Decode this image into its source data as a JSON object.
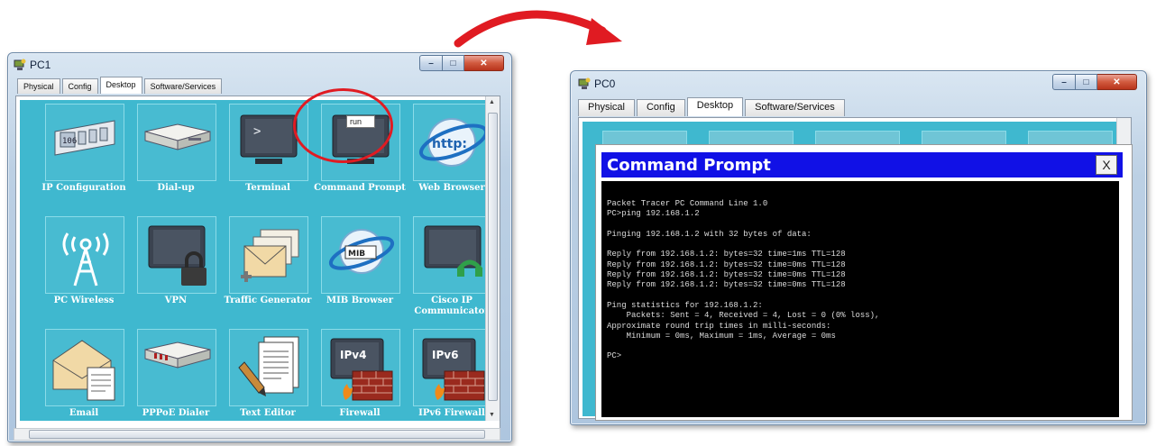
{
  "pc1": {
    "title": "PC1",
    "tabs": [
      "Physical",
      "Config",
      "Desktop",
      "Software/Services"
    ],
    "active_tab": "Desktop",
    "apps": [
      {
        "label": "IP Configuration",
        "icon": "ip-config-icon"
      },
      {
        "label": "Dial-up",
        "icon": "modem-icon"
      },
      {
        "label": "Terminal",
        "icon": "terminal-icon"
      },
      {
        "label": "Command Prompt",
        "icon": "command-prompt-icon"
      },
      {
        "label": "Web Browser",
        "icon": "web-browser-icon"
      },
      {
        "label": "PC Wireless",
        "icon": "wireless-antenna-icon"
      },
      {
        "label": "VPN",
        "icon": "vpn-lock-icon"
      },
      {
        "label": "Traffic Generator",
        "icon": "envelopes-icon"
      },
      {
        "label": "MIB Browser",
        "icon": "mib-browser-icon"
      },
      {
        "label": "Cisco IP Communicator",
        "icon": "ip-phone-monitor-icon"
      },
      {
        "label": "Email",
        "icon": "email-icon"
      },
      {
        "label": "PPPoE Dialer",
        "icon": "pppoe-modem-icon"
      },
      {
        "label": "Text Editor",
        "icon": "text-editor-icon"
      },
      {
        "label": "Firewall",
        "icon": "firewall-ipv4-icon"
      },
      {
        "label": "IPv6 Firewall",
        "icon": "firewall-ipv6-icon"
      }
    ],
    "icon_text": {
      "ip_config": "106",
      "browser": "http:",
      "mib": "MIB",
      "ipv4": "IPv4",
      "ipv6": "IPv6"
    },
    "tooltip": "run"
  },
  "pc0": {
    "title": "PC0",
    "tabs": [
      "Physical",
      "Config",
      "Desktop",
      "Software/Services"
    ],
    "active_tab": "Desktop"
  },
  "command_prompt": {
    "title": "Command Prompt",
    "close_label": "X",
    "lines": [
      "Packet Tracer PC Command Line 1.0",
      "PC>ping 192.168.1.2",
      "",
      "Pinging 192.168.1.2 with 32 bytes of data:",
      "",
      "Reply from 192.168.1.2: bytes=32 time=1ms TTL=128",
      "Reply from 192.168.1.2: bytes=32 time=0ms TTL=128",
      "Reply from 192.168.1.2: bytes=32 time=0ms TTL=128",
      "Reply from 192.168.1.2: bytes=32 time=0ms TTL=128",
      "",
      "Ping statistics for 192.168.1.2:",
      "    Packets: Sent = 4, Received = 4, Lost = 0 (0% loss),",
      "Approximate round trip times in milli-seconds:",
      "    Minimum = 0ms, Maximum = 1ms, Average = 0ms",
      "",
      "PC>"
    ]
  },
  "colors": {
    "desktop_bg": "#3fb8cf",
    "highlight": "#e01b22",
    "cmd_titlebar": "#1111e6"
  }
}
